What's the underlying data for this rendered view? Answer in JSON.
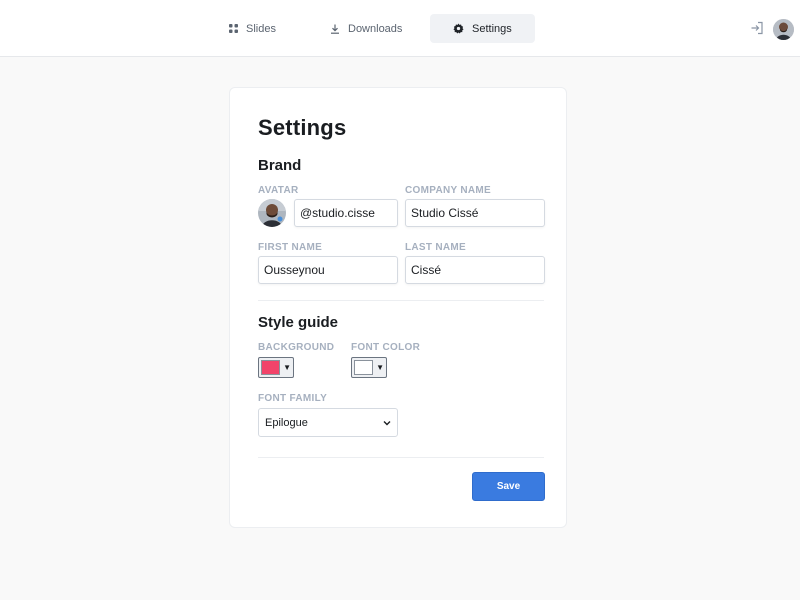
{
  "nav": {
    "tabs": [
      {
        "label": "Slides",
        "icon": "grid-icon"
      },
      {
        "label": "Downloads",
        "icon": "download-icon"
      },
      {
        "label": "Settings",
        "icon": "gear-icon",
        "active": true
      }
    ],
    "logout_icon": "logout-icon",
    "avatar_icon": "user-avatar"
  },
  "settings": {
    "title": "Settings",
    "brand": {
      "heading": "Brand",
      "avatar_label": "AVATAR",
      "handle_value": "@studio.cisse",
      "company_label": "COMPANY NAME",
      "company_value": "Studio Cissé",
      "first_name_label": "FIRST NAME",
      "first_name_value": "Ousseynou",
      "last_name_label": "LAST NAME",
      "last_name_value": "Cissé"
    },
    "style_guide": {
      "heading": "Style guide",
      "background_label": "BACKGROUND",
      "background_color": "#f2446a",
      "font_color_label": "FONT COLOR",
      "font_color": "#ffffff",
      "font_family_label": "FONT FAMILY",
      "font_family_value": "Epilogue"
    },
    "save_label": "Save"
  },
  "colors": {
    "accent": "#3a7be0"
  }
}
